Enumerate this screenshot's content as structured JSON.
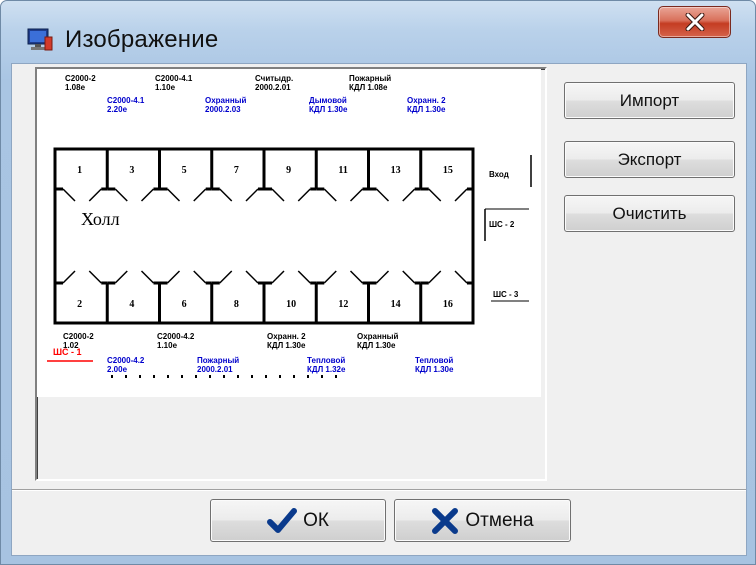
{
  "window": {
    "title": "Изображение",
    "icons": {
      "app": "monitor-app-icon",
      "close": "close-x-icon"
    },
    "colors": {
      "close_button": "#c94a33",
      "title_bar": "#b9d1ea"
    }
  },
  "image": {
    "top_labels": [
      {
        "name": "С2000-2",
        "addr": "1.08е",
        "color": "#000000"
      },
      {
        "name": "С2000-4.1",
        "addr": "1.10е",
        "color": "#000000"
      },
      {
        "name": "Считыдр.",
        "addr": "2000.2.01",
        "color": "#000000"
      },
      {
        "name": "Пожарный",
        "addr": "КДЛ 1.08е",
        "color": "#000000"
      },
      {
        "name": "С2000-4.1",
        "addr": "2.20е",
        "color": "#0000cc"
      },
      {
        "name": "Охранный",
        "addr": "2000.2.03",
        "color": "#0000cc"
      },
      {
        "name": "Дымовой",
        "addr": "КДЛ 1.30е",
        "color": "#0000cc"
      },
      {
        "name": "Охранн. 2",
        "addr": "КДЛ 1.30е",
        "color": "#0000cc"
      }
    ],
    "top_rooms": [
      "1",
      "3",
      "5",
      "7",
      "9",
      "11",
      "13",
      "15"
    ],
    "bottom_rooms": [
      "2",
      "4",
      "6",
      "8",
      "10",
      "12",
      "14",
      "16"
    ],
    "corridor_label": "Холл",
    "right_labels": [
      "Вход",
      "ШС - 2",
      "ШС - 3"
    ],
    "bottom_labels": [
      {
        "name": "С2000-2",
        "addr": "1.02",
        "color": "#000000"
      },
      {
        "name": "С2000-4.2",
        "addr": "1.10е",
        "color": "#000000"
      },
      {
        "name": "Охранн. 2",
        "addr": "КДЛ 1.30е",
        "color": "#000000"
      },
      {
        "name": "Охранный",
        "addr": "КДЛ 1.30е",
        "color": "#000000"
      },
      {
        "name": "С2000-4.2",
        "addr": "2.00е",
        "color": "#0000cc"
      },
      {
        "name": "Пожарный",
        "addr": "2000.2.01",
        "color": "#0000cc"
      },
      {
        "name": "Тепловой",
        "addr": "КДЛ 1.32е",
        "color": "#0000cc"
      },
      {
        "name": "Тепловой",
        "addr": "КДЛ 1.30е",
        "color": "#0000cc"
      }
    ],
    "loop_label": "ШС - 1",
    "loop_label_color": "#ff0000"
  },
  "buttons": {
    "import": "Импорт",
    "export": "Экспорт",
    "clear": "Очистить",
    "ok": "ОК",
    "cancel": "Отмена",
    "ok_icon": "checkmark-icon",
    "cancel_icon": "cross-icon",
    "ok_icon_color": "#0a3a8c",
    "cancel_icon_color": "#0a3a8c"
  }
}
